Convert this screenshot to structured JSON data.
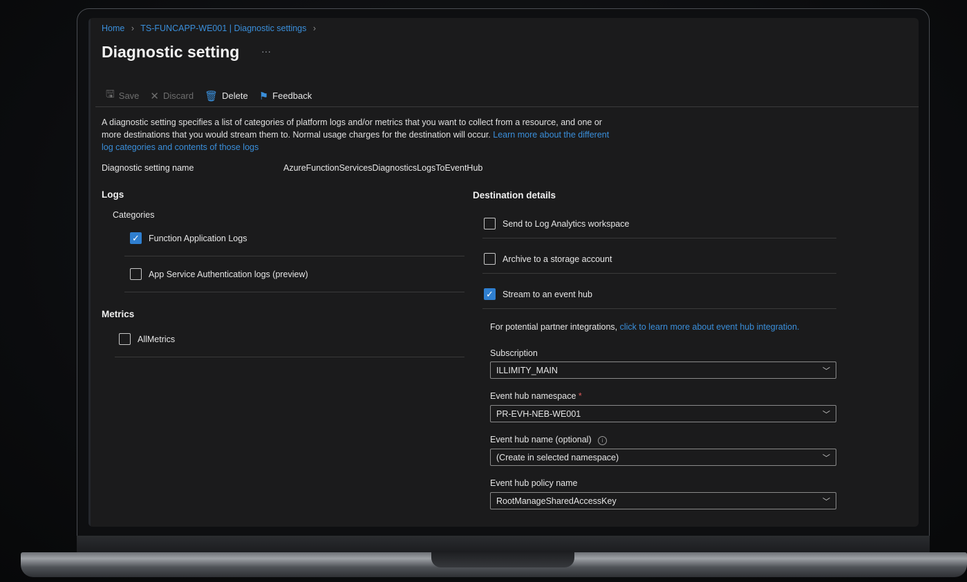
{
  "breadcrumb": {
    "home": "Home",
    "resource": "TS-FUNCAPP-WE001 | Diagnostic settings"
  },
  "page": {
    "title": "Diagnostic setting",
    "more": "···"
  },
  "toolbar": {
    "save": "Save",
    "discard": "Discard",
    "delete": "Delete",
    "feedback": "Feedback"
  },
  "description": {
    "text": "A diagnostic setting specifies a list of categories of platform logs and/or metrics that you want to collect from a resource, and one or more destinations that you would stream them to. Normal usage charges for the destination will occur.",
    "link": "Learn more about the different log categories and contents of those logs"
  },
  "setting_name": {
    "label": "Diagnostic setting name",
    "value": "AzureFunctionServicesDiagnosticsLogsToEventHub"
  },
  "logs": {
    "heading": "Logs",
    "categories_label": "Categories",
    "items": [
      {
        "label": "Function Application Logs",
        "checked": true
      },
      {
        "label": "App Service Authentication logs (preview)",
        "checked": false
      }
    ]
  },
  "metrics": {
    "heading": "Metrics",
    "items": [
      {
        "label": "AllMetrics",
        "checked": false
      }
    ]
  },
  "destination": {
    "heading": "Destination details",
    "options": [
      {
        "label": "Send to Log Analytics workspace",
        "checked": false
      },
      {
        "label": "Archive to a storage account",
        "checked": false
      },
      {
        "label": "Stream to an event hub",
        "checked": true
      }
    ],
    "partner_text": "For potential partner integrations,",
    "partner_link": "click to learn more about event hub integration.",
    "fields": {
      "subscription": {
        "label": "Subscription",
        "value": "ILLIMITY_MAIN"
      },
      "namespace": {
        "label": "Event hub namespace",
        "required": "*",
        "value": "PR-EVH-NEB-WE001"
      },
      "hub_name": {
        "label": "Event hub name (optional)",
        "info": "i",
        "value": "(Create in selected namespace)"
      },
      "policy": {
        "label": "Event hub policy name",
        "value": "RootManageSharedAccessKey"
      }
    }
  }
}
